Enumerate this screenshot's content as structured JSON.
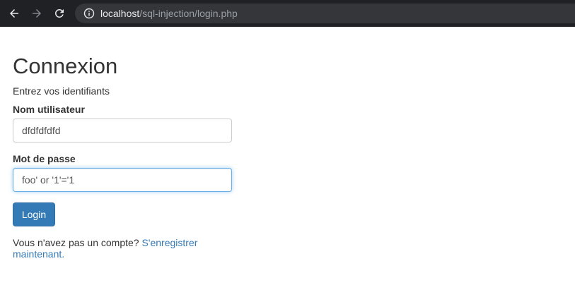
{
  "browser": {
    "url_host": "localhost",
    "url_path": "/sql-injection/login.php",
    "back_icon": "arrow-left-icon",
    "forward_icon": "arrow-right-icon",
    "reload_icon": "reload-icon",
    "info_icon": "info-icon"
  },
  "page": {
    "title": "Connexion",
    "subtitle": "Entrez vos identifiants",
    "username_label": "Nom utilisateur",
    "username_value": "dfdfdfdfd",
    "password_label": "Mot de passe",
    "password_value": "foo' or '1'='1",
    "login_label": "Login",
    "register_prompt": "Vous n'avez pas un compte?",
    "register_link": "S'enregistrer maintenant."
  },
  "colors": {
    "toolbar_bg": "#202124",
    "omnibox_bg": "#35363a",
    "link": "#337ab7",
    "primary_button": "#337ab7",
    "focus_border": "#66afe9"
  }
}
